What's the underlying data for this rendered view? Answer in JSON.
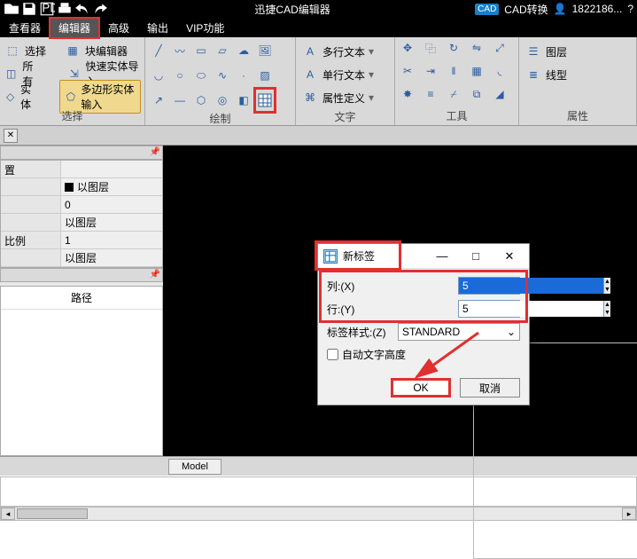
{
  "title": "迅捷CAD编辑器",
  "topright": {
    "convert": "CAD转换",
    "user": "1822186..."
  },
  "menu": {
    "viewer": "查看器",
    "editor": "编辑器",
    "advanced": "高级",
    "output": "输出",
    "vip": "VIP功能"
  },
  "ribbon": {
    "sel": {
      "select": "选择",
      "blockedit": "块编辑器",
      "all": "所有",
      "fastimport": "快速实体导入",
      "entity": "实体",
      "polyinput": "多边形实体输入",
      "label": "选择"
    },
    "draw": {
      "label": "绘制"
    },
    "text": {
      "mtext": "多行文本",
      "stext": "单行文本",
      "attdef": "属性定义",
      "label": "文字"
    },
    "tool": {
      "label": "工具"
    },
    "layer": {
      "linetype": "线型",
      "layer": "图层",
      "label": "属性"
    }
  },
  "props": {
    "k0": "置",
    "v0": "",
    "v1": "以图层",
    "v2": "0",
    "v3": "以图层",
    "k4": "比例",
    "v4": "1",
    "v5": "以图层"
  },
  "path": {
    "header": "路径"
  },
  "dialog": {
    "title": "新标签",
    "col_label": "列:(X)",
    "col_val": "5",
    "row_label": "行:(Y)",
    "row_val": "5",
    "style_label": "标签样式:(Z)",
    "style_val": "STANDARD",
    "autoh": "自动文字高度",
    "ok": "OK",
    "cancel": "取消"
  },
  "bottom": {
    "model": "Model"
  }
}
